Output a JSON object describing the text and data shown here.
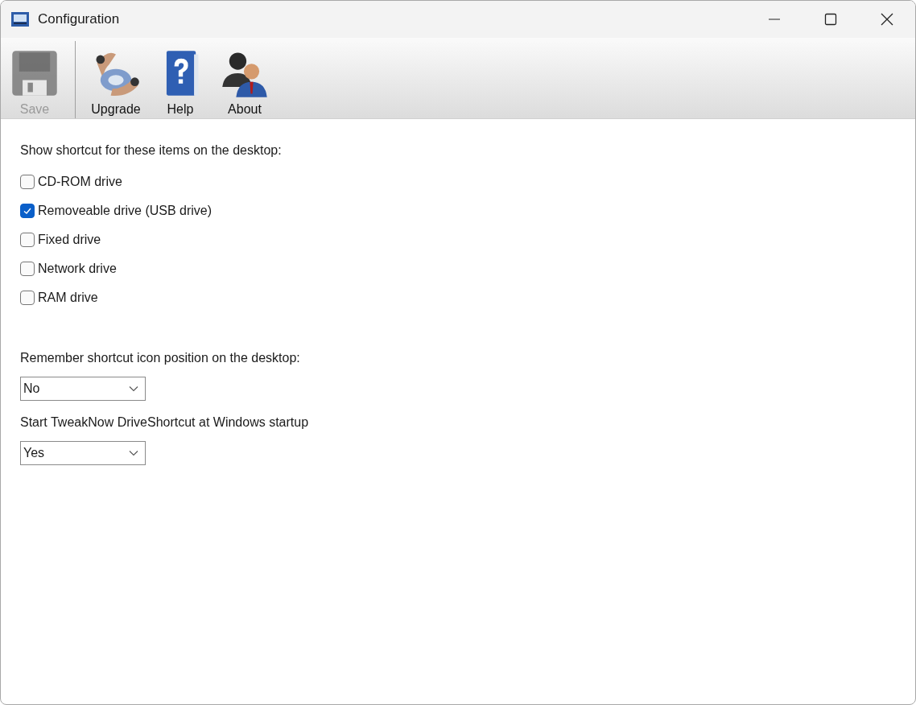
{
  "window": {
    "title": "Configuration"
  },
  "toolbar": [
    {
      "kind": "save",
      "label": "Save",
      "disabled": true
    },
    {
      "kind": "upgrade",
      "label": "Upgrade",
      "disabled": false
    },
    {
      "kind": "help",
      "label": "Help",
      "disabled": false
    },
    {
      "kind": "about",
      "label": "About",
      "disabled": false
    }
  ],
  "shortcuts": {
    "heading": "Show shortcut for these items on the desktop:",
    "items": [
      {
        "label": "CD-ROM drive",
        "checked": false
      },
      {
        "label": "Removeable drive (USB drive)",
        "checked": true
      },
      {
        "label": "Fixed drive",
        "checked": false
      },
      {
        "label": "Network drive",
        "checked": false
      },
      {
        "label": "RAM drive",
        "checked": false
      }
    ]
  },
  "settings": [
    {
      "label": "Remember shortcut icon position on the desktop:",
      "value": "No"
    },
    {
      "label": "Start TweakNow DriveShortcut at Windows startup",
      "value": "Yes"
    }
  ]
}
